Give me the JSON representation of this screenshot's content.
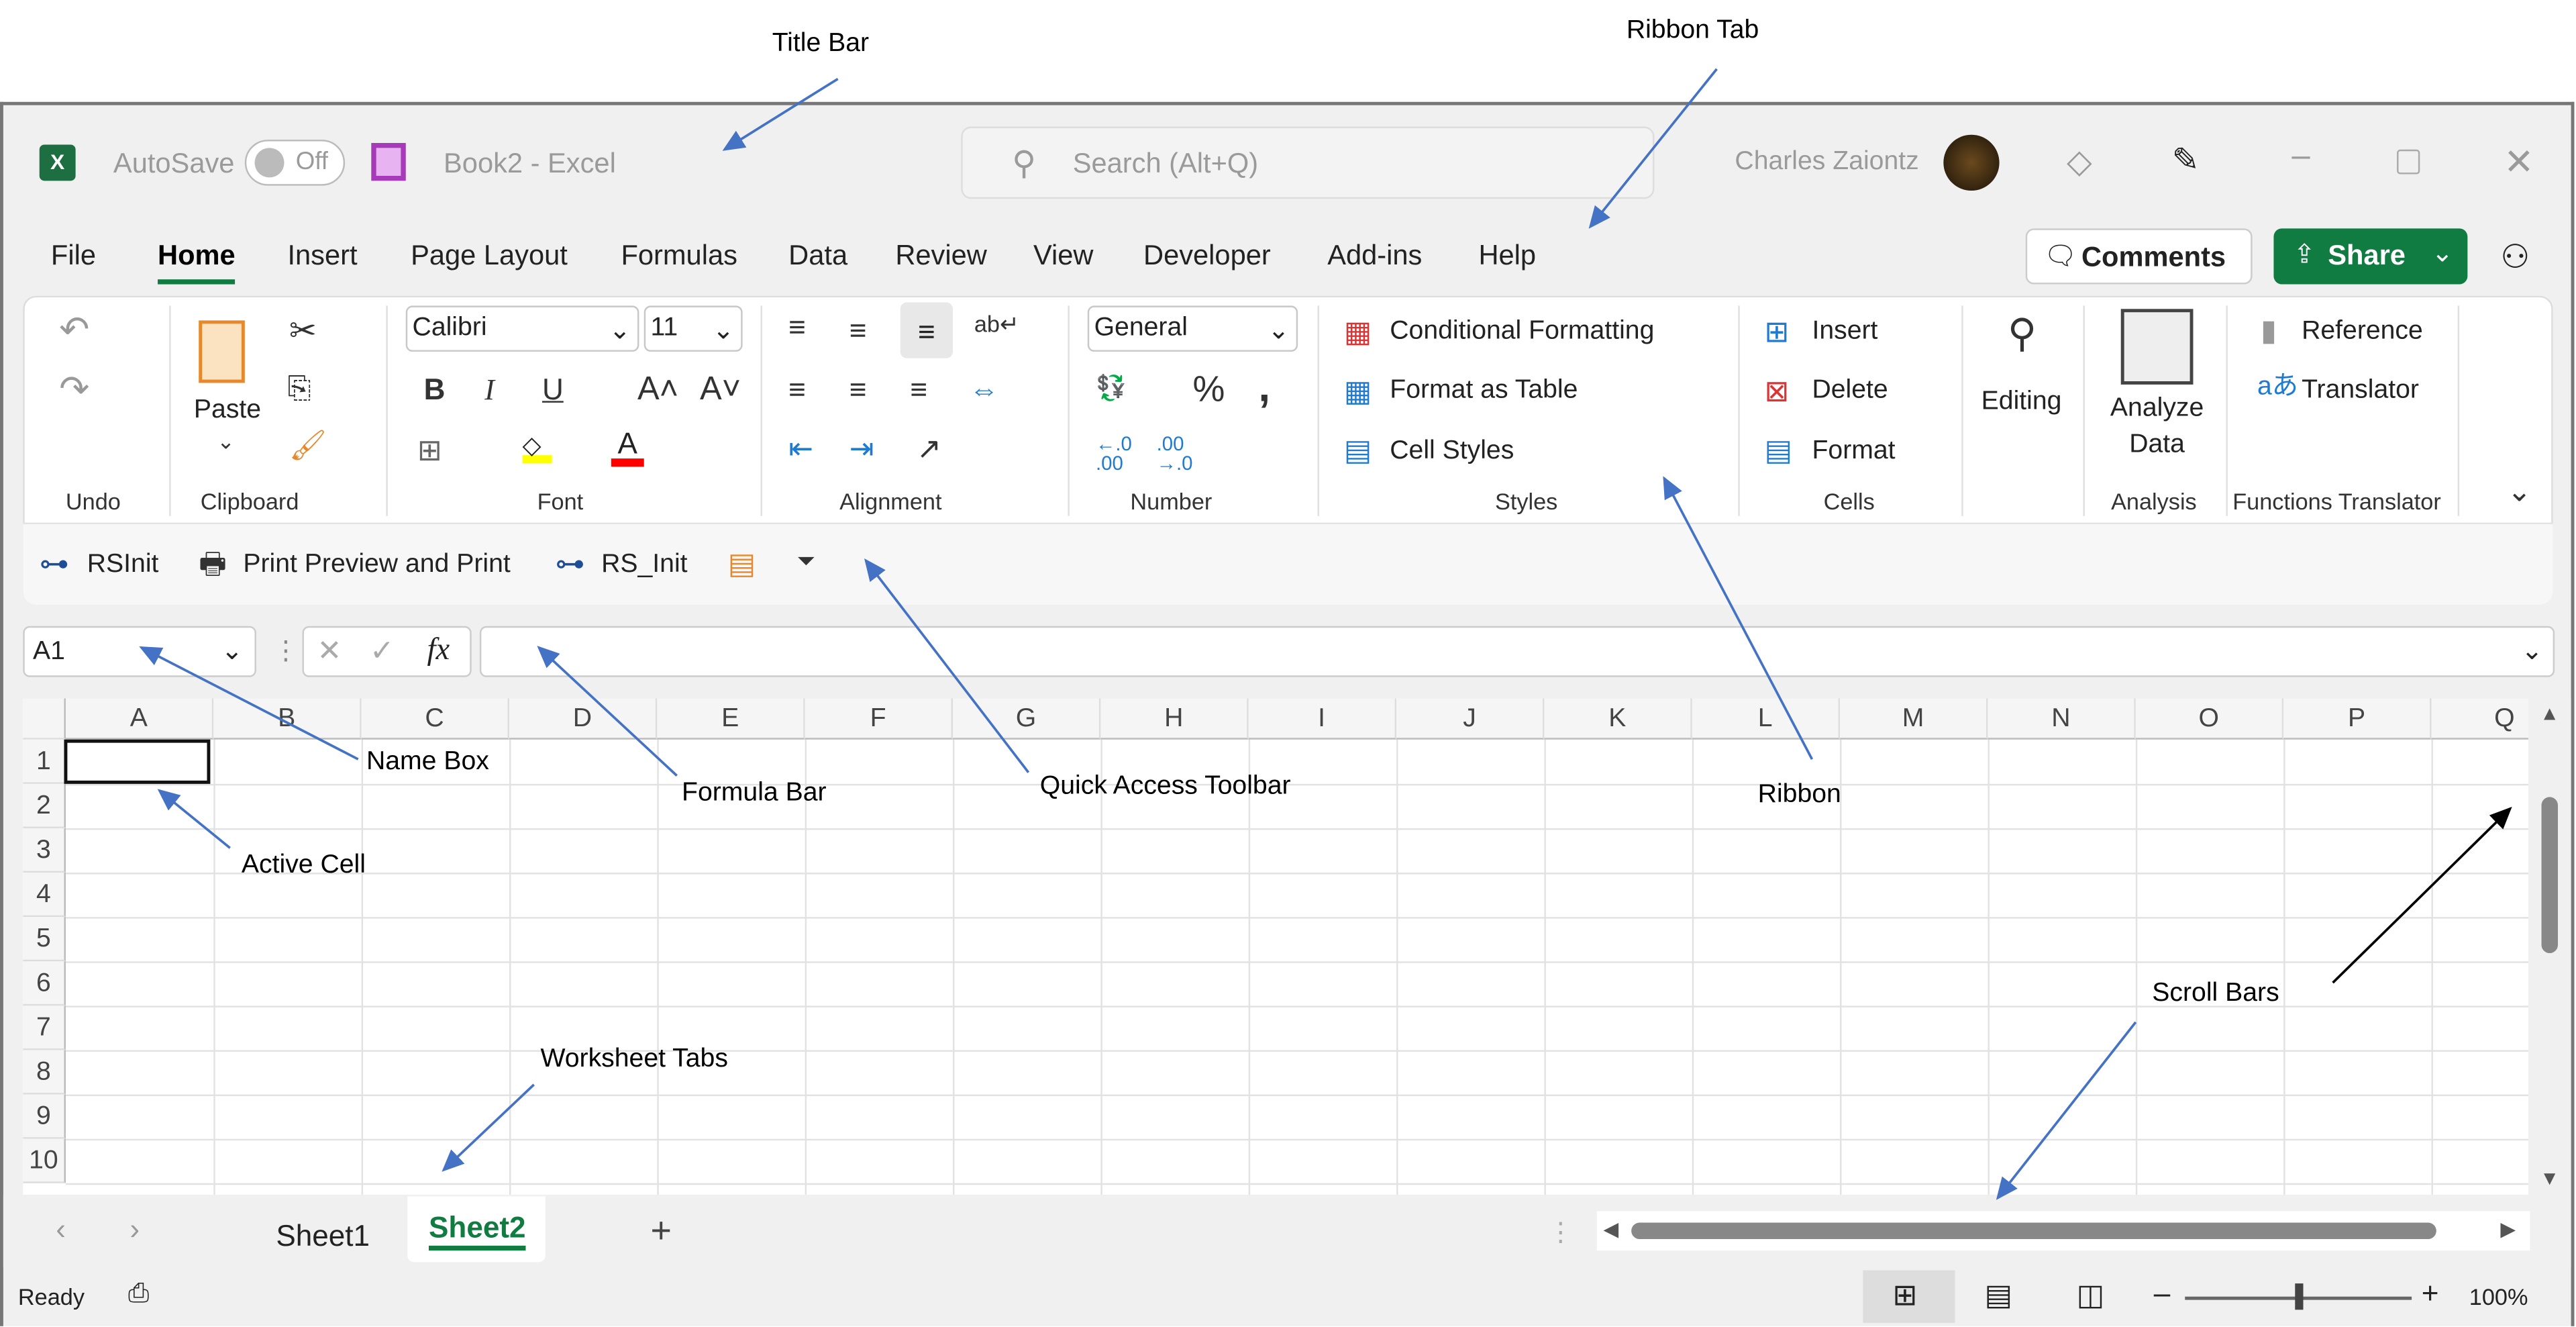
{
  "annotations": {
    "title_bar": "Title Bar",
    "ribbon_tab": "Ribbon Tab",
    "name_box": "Name Box",
    "formula_bar": "Formula Bar",
    "quick_access_toolbar": "Quick Access Toolbar",
    "ribbon": "Ribbon",
    "active_cell": "Active Cell",
    "worksheet_tabs": "Worksheet Tabs",
    "scroll_bars": "Scroll Bars"
  },
  "title": {
    "autosave": "AutoSave",
    "toggle": "Off",
    "document": "Book2  -  Excel",
    "search_placeholder": "Search (Alt+Q)",
    "user": "Charles Zaiontz"
  },
  "tabs": [
    "File",
    "Home",
    "Insert",
    "Page Layout",
    "Formulas",
    "Data",
    "Review",
    "View",
    "Developer",
    "Add-ins",
    "Help"
  ],
  "active_tab": "Home",
  "buttons": {
    "comments": "Comments",
    "share": "Share"
  },
  "ribbon": {
    "groups": {
      "undo": "Undo",
      "clipboard": "Clipboard",
      "font": "Font",
      "alignment": "Alignment",
      "number": "Number",
      "styles": "Styles",
      "cells": "Cells",
      "analysis": "Analysis",
      "functions_translator": "Functions Translator"
    },
    "paste": "Paste",
    "font_name": "Calibri",
    "font_size": "11",
    "number_format": "General",
    "bold": "B",
    "italic": "I",
    "underline": "U",
    "percent": "%",
    "comma": ",",
    "conditional_formatting": "Conditional Formatting",
    "format_as_table": "Format as Table",
    "cell_styles": "Cell Styles",
    "insert": "Insert",
    "delete": "Delete",
    "format": "Format",
    "editing": "Editing",
    "analyze_data": "Analyze Data",
    "reference": "Reference",
    "translator": "Translator",
    "colors": {
      "highlight": "#ffff00",
      "font_color": "#ff0000"
    }
  },
  "qat": {
    "items": [
      "RSInit",
      "Print Preview and Print",
      "RS_Init"
    ]
  },
  "formula_bar": {
    "name_box": "A1",
    "fx": "fx",
    "value": ""
  },
  "grid": {
    "columns": [
      "A",
      "B",
      "C",
      "D",
      "E",
      "F",
      "G",
      "H",
      "I",
      "J",
      "K",
      "L",
      "M",
      "N",
      "O",
      "P",
      "Q"
    ],
    "rows": [
      "1",
      "2",
      "3",
      "4",
      "5",
      "6",
      "7",
      "8",
      "9",
      "10"
    ],
    "active_cell": "A1"
  },
  "sheets": {
    "tabs": [
      "Sheet1",
      "Sheet2"
    ],
    "active": "Sheet2",
    "add": "+"
  },
  "status": {
    "ready": "Ready",
    "zoom": "100%",
    "zoom_level_percent": 100
  },
  "colors": {
    "accent": "#107c41",
    "annotation_arrow": "#4472c4"
  }
}
